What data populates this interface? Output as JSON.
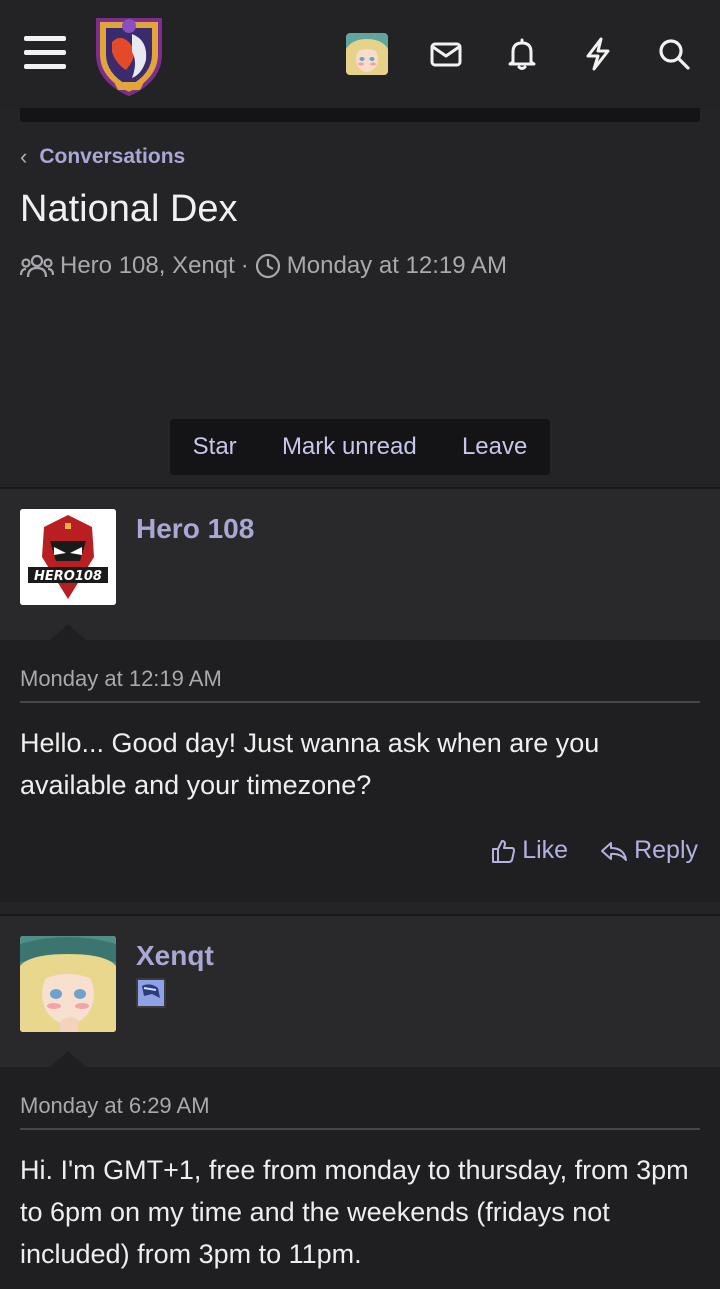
{
  "header": {
    "menu_icon": "hamburger-menu-icon",
    "logo": "site-logo",
    "icons": [
      "mail-icon",
      "bell-icon",
      "lightning-icon",
      "search-icon"
    ]
  },
  "breadcrumb": {
    "label": "Conversations"
  },
  "conversation": {
    "title": "National Dex",
    "participants": "Hero 108, Xenqt",
    "separator": "·",
    "started": "Monday at 12:19 AM"
  },
  "actions": {
    "star": "Star",
    "mark_unread": "Mark unread",
    "leave": "Leave"
  },
  "messages": [
    {
      "author": "Hero 108",
      "date": "Monday at 12:19 AM",
      "text": "Hello... Good day! Just wanna ask when are you available and your timezone?",
      "like": "Like",
      "reply": "Reply"
    },
    {
      "author": "Xenqt",
      "date": "Monday at 6:29 AM",
      "text": "Hi. I'm GMT+1, free from monday to thursday, from 3pm to 6pm on my time and the weekends (fridays not included) from 3pm to 11pm."
    }
  ],
  "colors": {
    "accent": "#a9a7d4",
    "background": "#242426",
    "panel": "#1f1f21"
  }
}
